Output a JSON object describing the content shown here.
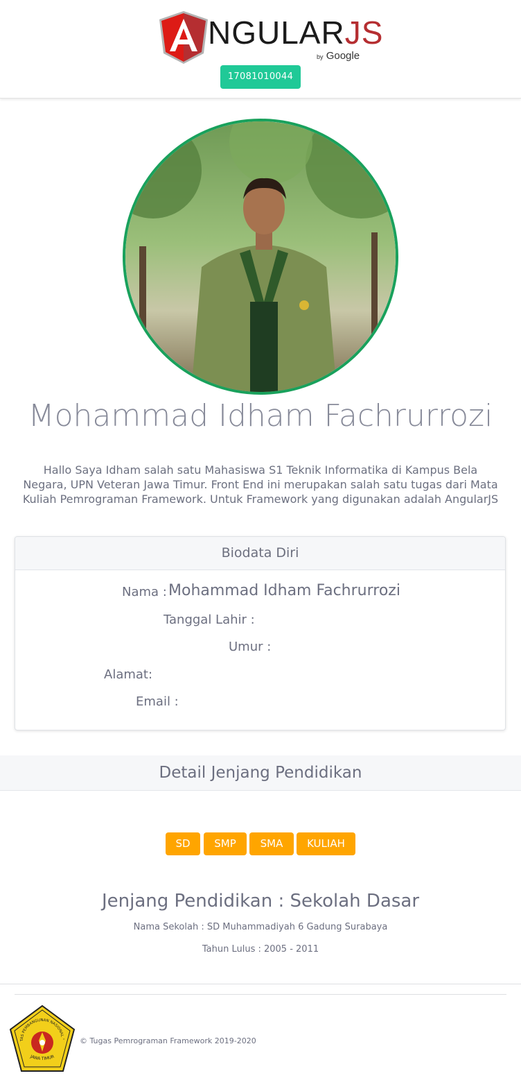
{
  "header": {
    "logo_text_main": "NGULAR",
    "logo_text_js": "JS",
    "logo_by": "by",
    "logo_google": "Google",
    "nim": "17081010044"
  },
  "profile": {
    "name": "Mohammad Idham Fachrurrozi",
    "intro": "Hallo Saya Idham salah satu Mahasiswa S1 Teknik Informatika di Kampus Bela Negara, UPN Veteran Jawa Timur. Front End ini merupakan salah satu tugas dari Mata Kuliah Pemrograman Framework. Untuk Framework yang digunakan adalah AngularJS"
  },
  "biodata": {
    "title": "Biodata Diri",
    "nama_label": "Nama :",
    "nama_value": "Mohammad Idham Fachrurrozi",
    "tanggal_label": "Tanggal Lahir :",
    "umur_label": "Umur :",
    "alamat_label": "Alamat:",
    "email_label": "Email :"
  },
  "pendidikan": {
    "section_title": "Detail Jenjang Pendidikan",
    "levels": [
      "SD",
      "SMP",
      "SMA",
      "KULIAH"
    ],
    "jenjang": "Jenjang Pendidikan : Sekolah Dasar",
    "nama_sekolah": "Nama Sekolah : SD Muhammadiyah 6 Gadung Surabaya",
    "tahun_lulus": "Tahun Lulus : 2005 - 2011"
  },
  "footer": {
    "copyright": "© Tugas Pemrograman Framework 2019-2020",
    "seal_top": "UNIVERSITAS PEMBANGUNAN NASIONAL \"VETERAN\"",
    "seal_bottom": "JAWA TIMUR"
  },
  "colors": {
    "nim_button": "#20c997",
    "level_button": "#ffa500",
    "photo_border": "#19a15c",
    "angular_red": "#dd1b16"
  }
}
